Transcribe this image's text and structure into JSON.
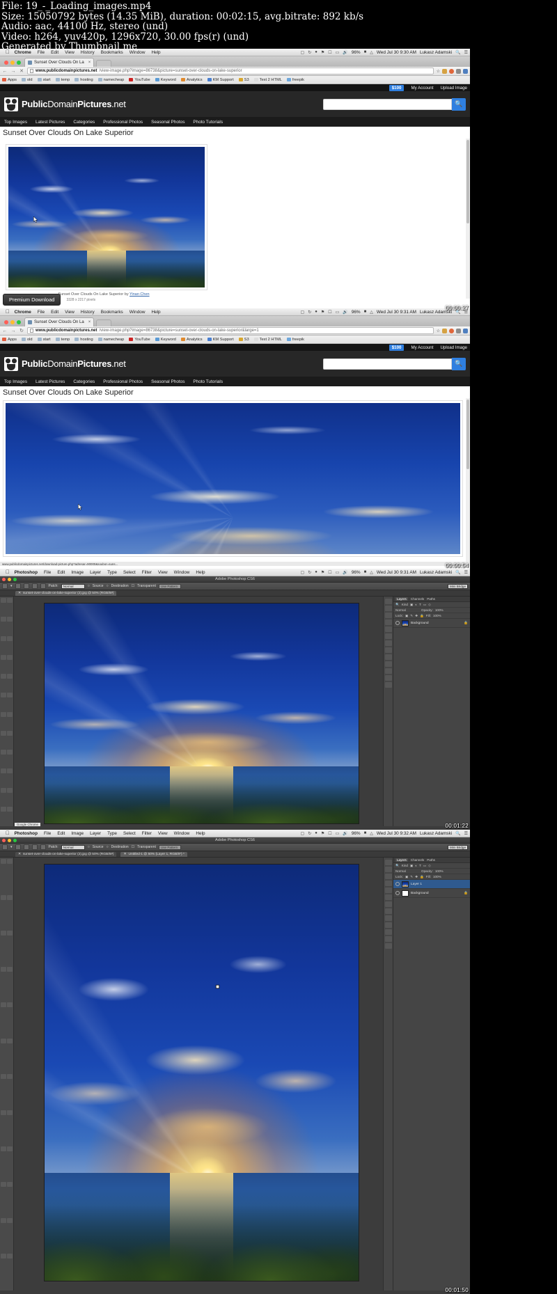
{
  "video_info": {
    "line1": "File: 19_-_Loading_images.mp4",
    "line2": "Size: 15050792 bytes (14.35 MiB), duration: 00:02:15, avg.bitrate: 892 kb/s",
    "line3": "Audio: aac, 44100 Hz, stereo (und)",
    "line4": "Video: h264, yuv420p, 1296x720, 30.00 fps(r) (und)",
    "line5": "Generated by Thumbnail me"
  },
  "menubar": {
    "apple": "&#63743;",
    "chrome_items": [
      "Chrome",
      "File",
      "Edit",
      "View",
      "History",
      "Bookmarks",
      "Window",
      "Help"
    ],
    "photoshop_items": [
      "Photoshop",
      "File",
      "Edit",
      "Image",
      "Layer",
      "Type",
      "Select",
      "Filter",
      "View",
      "Window",
      "Help"
    ],
    "battery": "96%",
    "user": "Lukasz Adamski",
    "clock_1": "Wed Jul 30  9:30 AM",
    "clock_2": "Wed Jul 30  9:31 AM",
    "clock_3": "Wed Jul 30  9:31 AM",
    "clock_4": "Wed Jul 30  9:32 AM",
    "right_icons": [
      "dropbox-icon",
      "bluetooth-icon",
      "airplay-icon",
      "volume-icon",
      "battery-icon",
      "wifi-icon",
      "search-icon",
      "list-icon"
    ]
  },
  "chrome": {
    "tab_title": "Sunset Over Clouds On La",
    "tab_close": "×",
    "url_1_bold": "www.publicdomainpictures.net",
    "url_1_rest": "/view-image.php?image=86738&picture=sunset-over-clouds-on-lake-superior",
    "url_2_bold": "www.publicdomainpictures.net",
    "url_2_rest": "/view-image.php?image=86738&picture=sunset-over-clouds-on-lake-superior&large=1",
    "bookmarks": [
      "Apps",
      "old",
      "start",
      "temp",
      "hosting",
      "namecheap",
      "YouTube",
      "Keyword",
      "Analytics",
      "KM Support",
      "S3",
      "Text 2 HTML",
      "freepik"
    ],
    "status_link": "www.publicdomainpictures.net/download-picture.php?adresar=90000&soubor=suns..."
  },
  "site": {
    "price_badge": "$100",
    "account_link": "My Account",
    "upload_link": "Upload Image",
    "logo_a": "Public",
    "logo_b": "Domain",
    "logo_c": "Pictures",
    "logo_d": ".net",
    "search_placeholder": "",
    "search_icon": "search-icon",
    "nav": [
      "Top Images",
      "Latest Pictures",
      "Categories",
      "Professional Photos",
      "Seasonal Photos",
      "Photo Tutorials"
    ],
    "page_title": "Sunset Over Clouds On Lake Superior",
    "caption_text": "Sunset Over Clouds On Lake Superior by ",
    "caption_author": "Yinan Chen",
    "premium_button": "Premium Download",
    "premium_dims": "3328 x 2217 pixels"
  },
  "photoshop": {
    "app_title": "Adobe Photoshop CS6",
    "options": {
      "patch_label": "Patch:",
      "patch_value": "Normal",
      "source_label": "Source",
      "destination_label": "Destination",
      "transparent_label": "Transparent",
      "use_pattern": "Use Pattern",
      "right_field": "Mini Bridge"
    },
    "doc_tab_1": "sunset-over-clouds-on-lake-superior (2).jpg @ 50% (RGB/8#)",
    "doc_tab_2": "Untitled-1 @ 50% (Layer 1, RGB/8*) *",
    "panels": {
      "tabs": [
        "Layers",
        "Channels",
        "Paths"
      ],
      "kind_label": "Kind",
      "blend_mode": "Normal",
      "opacity_label": "Opacity:",
      "opacity_value": "100%",
      "lock_label": "Lock:",
      "fill_label": "Fill:",
      "fill_value": "100%"
    },
    "layers_frame3": [
      {
        "name": "Background",
        "locked": true
      }
    ],
    "layers_frame4": [
      {
        "name": "Layer 1",
        "locked": false
      },
      {
        "name": "Background",
        "locked": true
      }
    ],
    "status_frame3": "Google Chrome"
  },
  "timestamps": {
    "f1": "00:00:27",
    "f2": "00:00:54",
    "f3": "00:01:22",
    "f4": "00:01:50"
  }
}
